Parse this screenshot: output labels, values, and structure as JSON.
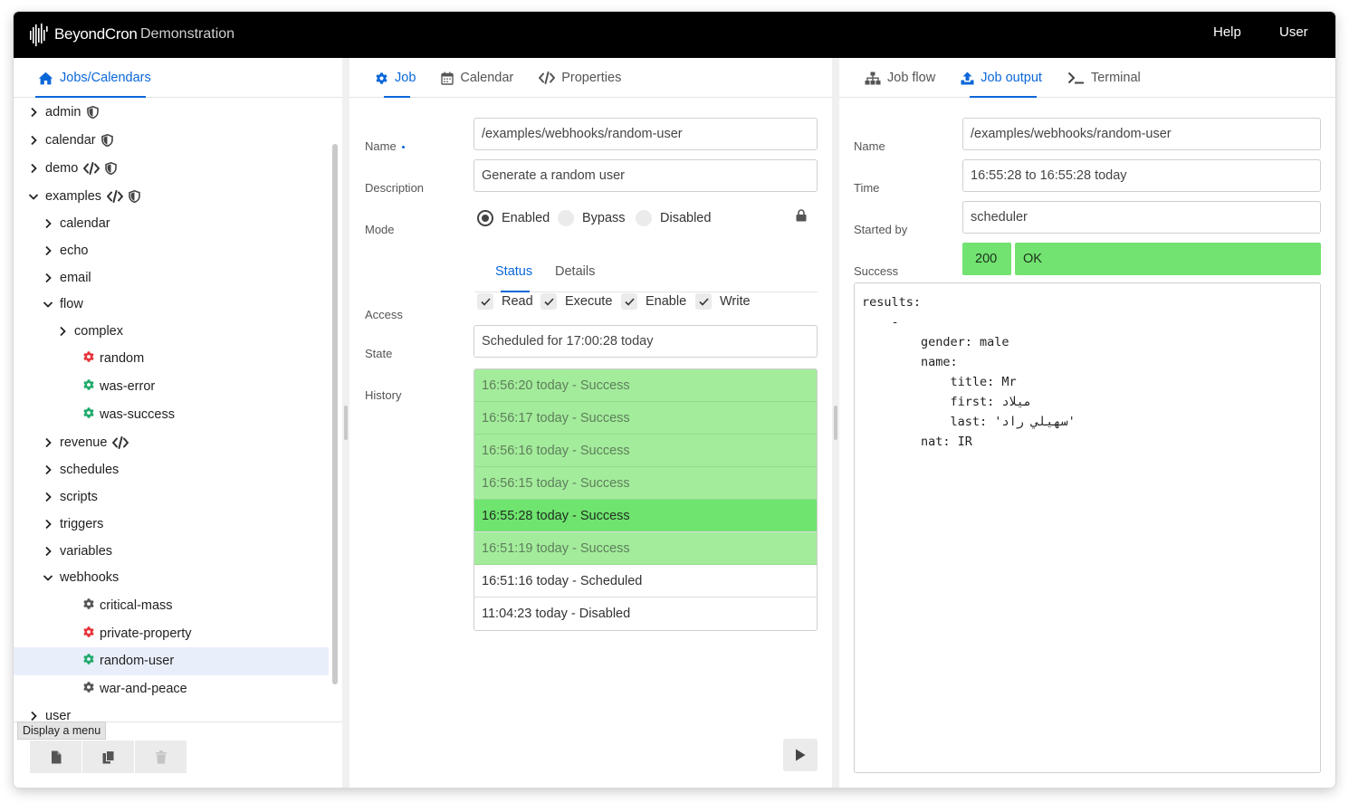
{
  "app": {
    "logo_text": "BeyondCron",
    "subtitle": "Demonstration",
    "help_label": "Help",
    "user_label": "User"
  },
  "left": {
    "tab_label": "Jobs/Calendars",
    "tree": [
      {
        "label": "admin",
        "kind": "folder",
        "state": "collapsed",
        "badges": [
          "shield-icon"
        ]
      },
      {
        "label": "calendar",
        "kind": "folder",
        "state": "collapsed",
        "badges": [
          "shield-icon"
        ]
      },
      {
        "label": "demo",
        "kind": "folder",
        "state": "collapsed",
        "badges": [
          "code-icon",
          "shield-icon"
        ]
      },
      {
        "label": "examples",
        "kind": "folder",
        "state": "expanded",
        "badges": [
          "code-icon",
          "shield-icon"
        ]
      },
      {
        "label": "calendar",
        "kind": "folder",
        "state": "collapsed"
      },
      {
        "label": "echo",
        "kind": "folder",
        "state": "collapsed"
      },
      {
        "label": "email",
        "kind": "folder",
        "state": "collapsed"
      },
      {
        "label": "flow",
        "kind": "folder",
        "state": "expanded"
      },
      {
        "label": "complex",
        "kind": "folder",
        "state": "collapsed"
      },
      {
        "label": "random",
        "kind": "job",
        "status": "error"
      },
      {
        "label": "was-error",
        "kind": "job",
        "status": "success"
      },
      {
        "label": "was-success",
        "kind": "job",
        "status": "success"
      },
      {
        "label": "revenue",
        "kind": "folder",
        "state": "collapsed",
        "badges": [
          "code-icon"
        ]
      },
      {
        "label": "schedules",
        "kind": "folder",
        "state": "collapsed"
      },
      {
        "label": "scripts",
        "kind": "folder",
        "state": "collapsed"
      },
      {
        "label": "triggers",
        "kind": "folder",
        "state": "collapsed"
      },
      {
        "label": "variables",
        "kind": "folder",
        "state": "collapsed"
      },
      {
        "label": "webhooks",
        "kind": "folder",
        "state": "expanded"
      },
      {
        "label": "critical-mass",
        "kind": "job",
        "status": "neutral"
      },
      {
        "label": "private-property",
        "kind": "job",
        "status": "error"
      },
      {
        "label": "random-user",
        "kind": "job",
        "status": "success",
        "selected": true
      },
      {
        "label": "war-and-peace",
        "kind": "job",
        "status": "neutral"
      },
      {
        "label": "user",
        "kind": "folder",
        "state": "collapsed"
      }
    ],
    "tooltip": "Display a menu"
  },
  "middle": {
    "tabs": [
      {
        "label": "Job",
        "icon": "gear-icon",
        "active": true
      },
      {
        "label": "Calendar",
        "icon": "calendar-icon",
        "active": false
      },
      {
        "label": "Properties",
        "icon": "code-icon",
        "active": false
      }
    ],
    "name_label": "Name",
    "name_value": "/examples/webhooks/random-user",
    "description_label": "Description",
    "description_value": "Generate a random user",
    "mode_label": "Mode",
    "mode_options": [
      "Enabled",
      "Bypass",
      "Disabled"
    ],
    "mode_selected": "Enabled",
    "subtabs": [
      "Status",
      "Details"
    ],
    "access_label": "Access",
    "access_options": [
      "Read",
      "Execute",
      "Enable",
      "Write"
    ],
    "state_label": "State",
    "state_value": "Scheduled for 17:00:28 today",
    "history_label": "History",
    "history": [
      {
        "text": "16:56:20 today - Success",
        "kind": "success"
      },
      {
        "text": "16:56:17 today - Success",
        "kind": "success"
      },
      {
        "text": "16:56:16 today - Success",
        "kind": "success"
      },
      {
        "text": "16:56:15 today - Success",
        "kind": "success"
      },
      {
        "text": "16:55:28 today - Success",
        "kind": "current"
      },
      {
        "text": "16:51:19 today - Success",
        "kind": "success"
      },
      {
        "text": "16:51:16 today - Scheduled",
        "kind": "plain"
      },
      {
        "text": "11:04:23 today - Disabled",
        "kind": "plain"
      }
    ]
  },
  "right": {
    "tabs": [
      {
        "label": "Job flow",
        "icon": "flow-icon",
        "active": false
      },
      {
        "label": "Job output",
        "icon": "upload-icon",
        "active": true
      },
      {
        "label": "Terminal",
        "icon": "terminal-icon",
        "active": false
      }
    ],
    "name_label": "Name",
    "name_value": "/examples/webhooks/random-user",
    "time_label": "Time",
    "time_value": "16:55:28 to 16:55:28 today",
    "started_by_label": "Started by",
    "started_by_value": "scheduler",
    "success_label": "Success",
    "status_code": "200",
    "status_text": "OK",
    "output": "results:\n    -\n        gender: male\n        name:\n            title: Mr\n            first: میلاد\n            last: 'سهیلي راد'\n        nat: IR"
  },
  "colors": {
    "accent": "#0a67d8",
    "success_light": "#a3ec9b",
    "success": "#6fe46f",
    "error": "#e5353b",
    "job_success": "#1faa6b"
  }
}
